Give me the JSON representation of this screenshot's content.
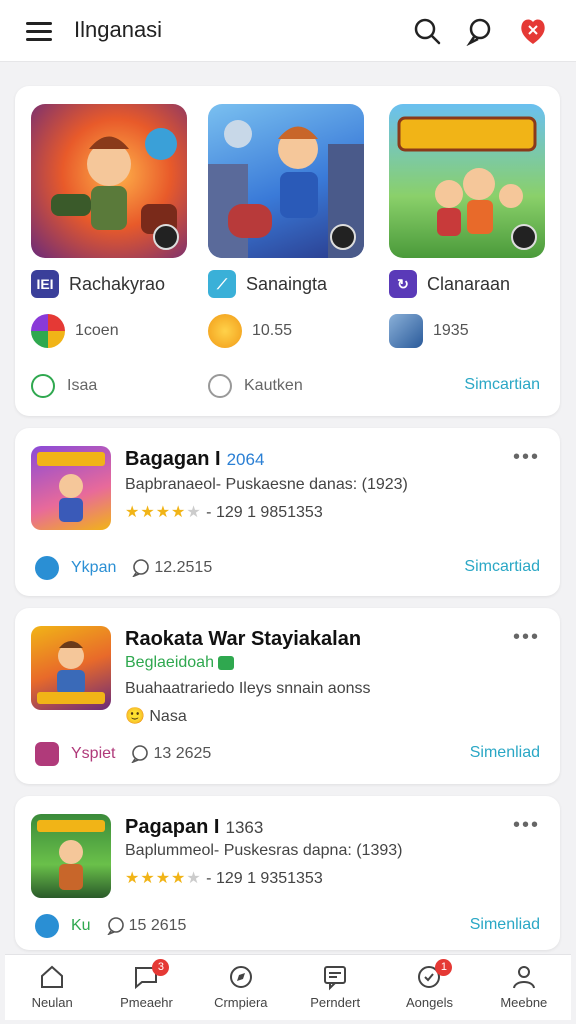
{
  "header": {
    "title": "Ilnganasi"
  },
  "featured": [
    {
      "name": "Rachakyrao",
      "stat": "1coen",
      "action": "Isaa"
    },
    {
      "name": "Sanaingta",
      "stat": "10.55",
      "action": "Kautken"
    },
    {
      "name": "Clanaraan",
      "stat": "1935",
      "link": "Simcartian"
    }
  ],
  "list": [
    {
      "title": "Bagagan I",
      "version": "2064",
      "subtitle": "Bapbranaeol- Puskaesne danas: (1923)",
      "stars": 4,
      "rating_text": "- 129 1 9851353",
      "foot_label": "Ykpan",
      "comments": "12.2515",
      "link": "Simcartiad",
      "foot_color": "#2a8fd4"
    },
    {
      "title": "Raokata War Stayiakalan",
      "green_text": "Beglaeidoah",
      "subtitle": "Buahaatrariedo  Ileys snnain aonss",
      "extra": "Nasa",
      "foot_label": "Yspiet",
      "comments": "13 2625",
      "link": "Simenliad",
      "foot_color": "#b03a7a"
    },
    {
      "title": "Pagapan I",
      "version": "1363",
      "subtitle": "Baplummeol- Puskesras dapna: (1393)",
      "stars": 4,
      "rating_text": "- 129 1 9351353",
      "foot_label": "Ku",
      "comments": "15 2615",
      "link": "Simenliad",
      "foot_color": "#2fa84f"
    }
  ],
  "nav": [
    {
      "label": "Neulan",
      "icon": "home-icon"
    },
    {
      "label": "Pmeaehr",
      "icon": "chat-icon",
      "badge": "3"
    },
    {
      "label": "Crmpiera",
      "icon": "compass-icon"
    },
    {
      "label": "Perndert",
      "icon": "message-icon"
    },
    {
      "label": "Aongels",
      "icon": "bell-icon",
      "badge": "1"
    },
    {
      "label": "Meebne",
      "icon": "profile-icon"
    }
  ]
}
